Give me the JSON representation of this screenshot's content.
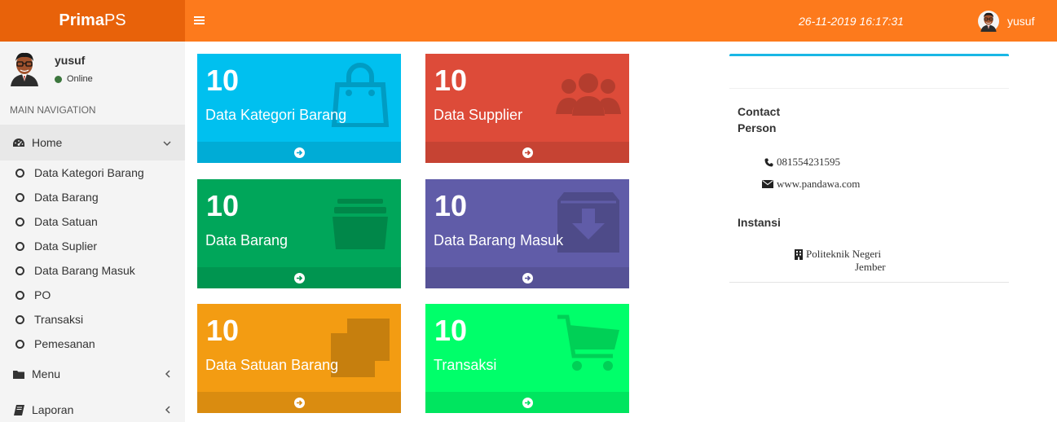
{
  "header": {
    "brand_bold": "Prima",
    "brand_light": "PS",
    "datetime": "26-11-2019 16:17:31",
    "username": "yusuf"
  },
  "sidebar": {
    "user": {
      "name": "yusuf",
      "status": "Online"
    },
    "nav_header": "MAIN NAVIGATION",
    "home": {
      "label": "Home",
      "icon": "dashboard-icon",
      "state": "expanded"
    },
    "home_items": [
      {
        "label": "Data Kategori Barang"
      },
      {
        "label": "Data Barang"
      },
      {
        "label": "Data Satuan"
      },
      {
        "label": "Data Suplier"
      },
      {
        "label": "Data Barang Masuk"
      },
      {
        "label": "PO"
      },
      {
        "label": "Transaksi"
      },
      {
        "label": "Pemesanan"
      }
    ],
    "menu": {
      "label": "Menu",
      "icon": "folder-icon"
    },
    "laporan": {
      "label": "Laporan",
      "icon": "book-icon"
    }
  },
  "tiles": [
    {
      "count": "10",
      "label": "Data Kategori Barang",
      "icon": "shopping-bag-icon",
      "color": "#00c0ef"
    },
    {
      "count": "10",
      "label": "Data Supplier",
      "icon": "users-icon",
      "color": "#dd4b39"
    },
    {
      "count": "10",
      "label": "Data Barang",
      "icon": "archive-icon",
      "color": "#00a65a"
    },
    {
      "count": "10",
      "label": "Data Barang Masuk",
      "icon": "download-box-icon",
      "color": "#605ca8"
    },
    {
      "count": "10",
      "label": "Data Satuan Barang",
      "icon": "clone-icon",
      "color": "#f39c12"
    },
    {
      "count": "10",
      "label": "Transaksi",
      "icon": "cart-icon",
      "color": "#00ff6a"
    }
  ],
  "contact": {
    "heading_line1": "Contact",
    "heading_line2": "Person",
    "phone": "081554231595",
    "website": "www.pandawa.com",
    "instansi_heading": "Instansi",
    "instansi_line1": "Politeknik Negeri",
    "instansi_line2": "Jember"
  },
  "colors": {
    "header": "#fd7a1c",
    "logo": "#e8620a",
    "sidebar": "#f4f4f4",
    "panel_accent": "#1ab7e5"
  }
}
